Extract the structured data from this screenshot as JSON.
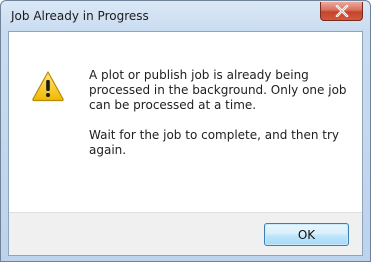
{
  "window": {
    "title": "Job Already in Progress"
  },
  "icons": {
    "close": "close-icon",
    "warning": "warning-icon"
  },
  "message": {
    "line1": "A plot or publish job is already being processed in the background. Only one job can be processed at a time.",
    "line2": "Wait for the job to complete, and then try again."
  },
  "buttons": {
    "ok_label": "OK"
  },
  "colors": {
    "close_button": "#c4452b",
    "ok_button_border": "#3c7fb1",
    "warning_fill": "#f5c300"
  }
}
